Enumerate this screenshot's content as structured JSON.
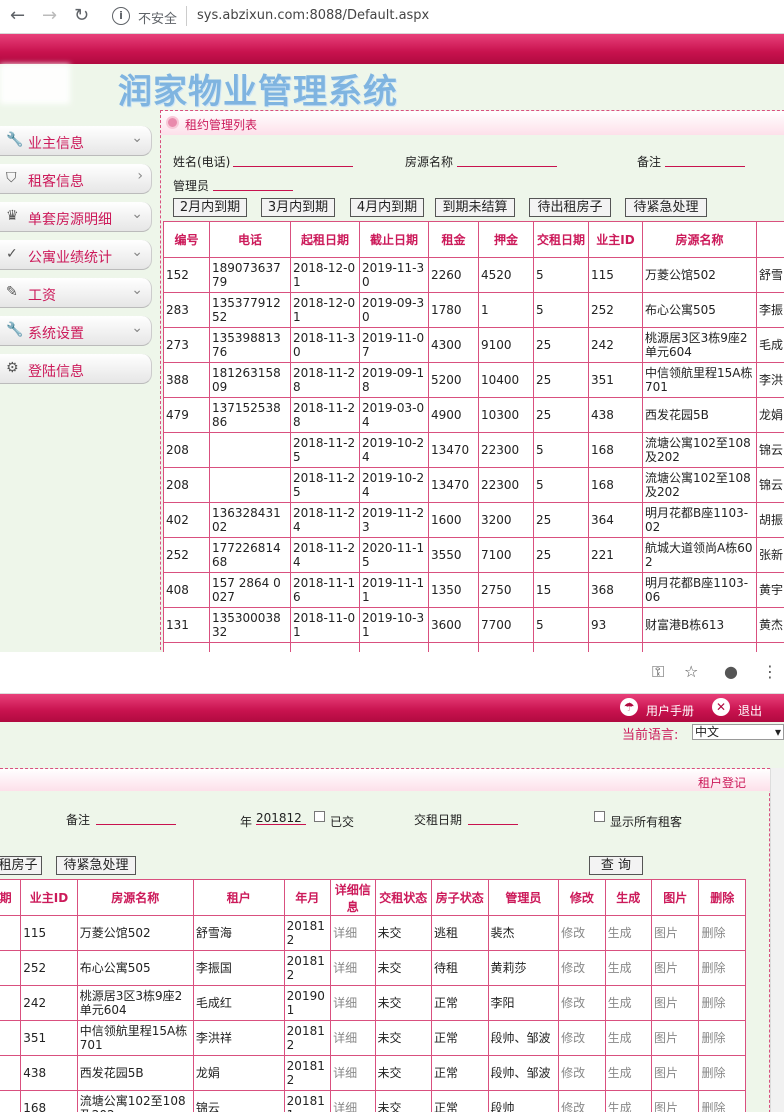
{
  "browser": {
    "back": "←",
    "forward": "→",
    "reload": "↻",
    "info": "i",
    "security": "不安全",
    "url": "sys.abzixun.com:8088/Default.aspx"
  },
  "logo": {
    "title": "中润家物业管理系统",
    "title_visible": "润家物业管理系统"
  },
  "sidebar": {
    "items": [
      {
        "label": "业主信息",
        "icon": "wrench-icon",
        "glyph": "🔧",
        "arrow": "⌄"
      },
      {
        "label": "租客信息",
        "icon": "filter-icon",
        "glyph": "⛉",
        "arrow": "›"
      },
      {
        "label": "单套房源明细",
        "icon": "crown-icon",
        "glyph": "♛",
        "arrow": "⌄"
      },
      {
        "label": "公寓业绩统计",
        "icon": "check-icon",
        "glyph": "✓",
        "arrow": "⌄"
      },
      {
        "label": "工资",
        "icon": "pencil-icon",
        "glyph": "✎",
        "arrow": "⌄"
      },
      {
        "label": "系统设置",
        "icon": "wrench-icon",
        "glyph": "🔧",
        "arrow": "⌄"
      },
      {
        "label": "登陆信息",
        "icon": "gear-icon",
        "glyph": "⚙",
        "arrow": ""
      }
    ]
  },
  "panel": {
    "title": "租约管理列表"
  },
  "filters": {
    "name_label": "姓名(电话)",
    "house_label": "房源名称",
    "note_label": "备注",
    "manager_label": "管理员"
  },
  "buttons": {
    "b1": "2月内到期",
    "b2": "3月内到期",
    "b3": "4月内到期",
    "b4": "到期未结算",
    "b5": "待出租房子",
    "b6": "待紧急处理"
  },
  "table1": {
    "headers": [
      "编号",
      "电话",
      "起租日期",
      "截止日期",
      "租金",
      "押金",
      "交租日期",
      "业主ID",
      "房源名称",
      ""
    ],
    "rows": [
      [
        "152",
        "18907363779",
        "2018-12-01",
        "2019-11-30",
        "2260",
        "4520",
        "5",
        "115",
        "万菱公馆502",
        "舒雪"
      ],
      [
        "283",
        "13537791252",
        "2018-12-01",
        "2019-09-30",
        "1780",
        "1",
        "5",
        "252",
        "布心公寓505",
        "李振"
      ],
      [
        "273",
        "13539881376",
        "2018-11-30",
        "2019-11-07",
        "4300",
        "9100",
        "25",
        "242",
        "桃源居3区3栋9座2单元604",
        "毛成"
      ],
      [
        "388",
        "18126315809",
        "2018-11-28",
        "2019-09-18",
        "5200",
        "10400",
        "25",
        "351",
        "中信领航里程15A栋701",
        "李洪"
      ],
      [
        "479",
        "13715253886",
        "2018-11-28",
        "2019-03-04",
        "4900",
        "10300",
        "25",
        "438",
        "西发花园5B",
        "龙娟"
      ],
      [
        "208",
        "",
        "2018-11-25",
        "2019-10-24",
        "13470",
        "22300",
        "5",
        "168",
        "流塘公寓102至108及202",
        "锦云"
      ],
      [
        "208",
        "",
        "2018-11-25",
        "2019-10-24",
        "13470",
        "22300",
        "5",
        "168",
        "流塘公寓102至108及202",
        "锦云"
      ],
      [
        "402",
        "13632843102",
        "2018-11-24",
        "2019-11-23",
        "1600",
        "3200",
        "25",
        "364",
        "明月花都B座1103-02",
        "胡振"
      ],
      [
        "252",
        "17722681468",
        "2018-11-24",
        "2020-11-15",
        "3550",
        "7100",
        "25",
        "221",
        "航城大道领尚A栋602",
        "张新"
      ],
      [
        "408",
        "157 2864 0027",
        "2018-11-16",
        "2019-11-11",
        "1350",
        "2750",
        "15",
        "368",
        "明月花都B座1103-06",
        "黄宇"
      ],
      [
        "131",
        "13530003832",
        "2018-11-01",
        "2019-10-31",
        "3600",
        "7700",
        "5",
        "93",
        "财富港B栋613",
        "黄杰"
      ],
      [
        "",
        "",
        "2018-10-",
        "2019-10-",
        "",
        "",
        "",
        "",
        "",
        ""
      ]
    ]
  },
  "browser2": {
    "key": "⚿",
    "star": "☆",
    "account": "●",
    "menu": "⋮"
  },
  "top2": {
    "manual": "用户手册",
    "logout": "退出",
    "lang_label": "当前语言:",
    "lang_value": "中文",
    "tenant_reg": "租户登记"
  },
  "filters2": {
    "note_label": "备注",
    "year_label": "年",
    "year_value": "201812",
    "paid_label": "已交",
    "pay_date_label": "交租日期",
    "show_all_label": "显示所有租客",
    "btn_house": "租房子",
    "btn_urgent": "待紧急处理",
    "btn_search": "查 询"
  },
  "table2": {
    "headers": [
      "期",
      "业主ID",
      "房源名称",
      "租户",
      "年月",
      "详细信息",
      "交租状态",
      "房子状态",
      "管理员",
      "修改",
      "生成",
      "图片",
      "删除"
    ],
    "rows": [
      [
        "",
        "115",
        "万菱公馆502",
        "舒雪海",
        "201812",
        "详细",
        "未交",
        "逃租",
        "裴杰",
        "修改",
        "生成",
        "图片",
        "删除"
      ],
      [
        "",
        "252",
        "布心公寓505",
        "李振国",
        "201812",
        "详细",
        "未交",
        "待租",
        "黄莉莎",
        "修改",
        "生成",
        "图片",
        "删除"
      ],
      [
        "",
        "242",
        "桃源居3区3栋9座2单元604",
        "毛成红",
        "201901",
        "详细",
        "未交",
        "正常",
        "李阳",
        "修改",
        "生成",
        "图片",
        "删除"
      ],
      [
        "",
        "351",
        "中信领航里程15A栋701",
        "李洪祥",
        "201812",
        "详细",
        "未交",
        "正常",
        "段帅、邹波",
        "修改",
        "生成",
        "图片",
        "删除"
      ],
      [
        "",
        "438",
        "西发花园5B",
        "龙娟",
        "201812",
        "详细",
        "未交",
        "正常",
        "段帅、邹波",
        "修改",
        "生成",
        "图片",
        "删除"
      ],
      [
        "",
        "168",
        "流塘公寓102至108及202",
        "锦云",
        "201811",
        "详细",
        "未交",
        "正常",
        "段帅",
        "修改",
        "生成",
        "图片",
        "删除"
      ]
    ]
  }
}
